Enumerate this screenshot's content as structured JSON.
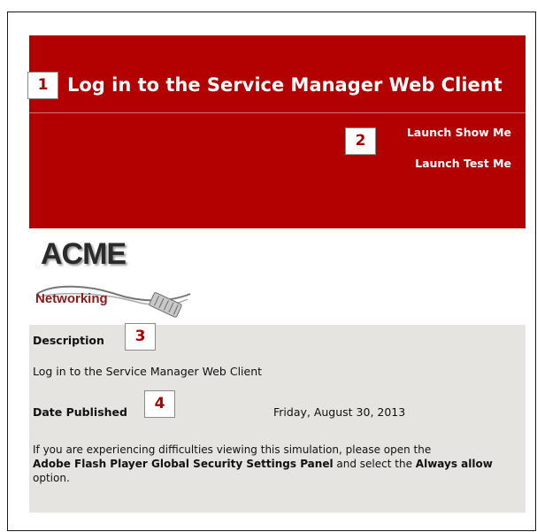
{
  "header": {
    "title": "Log in to the Service Manager Web Client",
    "links": {
      "show_me": "Launch Show Me",
      "test_me": "Launch Test Me"
    },
    "background_color": "#b30000"
  },
  "callouts": [
    "1",
    "2",
    "3",
    "4"
  ],
  "logo": {
    "name": "ACME",
    "tagline": "Networking"
  },
  "info": {
    "description_label": "Description",
    "description_text": "Log in to the Service Manager Web Client",
    "date_label": "Date Published",
    "date_value": "Friday, August 30, 2013",
    "notice": {
      "part1": "If you are experiencing difficulties viewing this simulation, please open the",
      "link": "Adobe Flash Player Global Security Settings Panel",
      "part2": "and select the",
      "option": "Always allow",
      "part3": "option."
    },
    "background_color": "#e6e4e0"
  },
  "accent_color": "#a60000"
}
